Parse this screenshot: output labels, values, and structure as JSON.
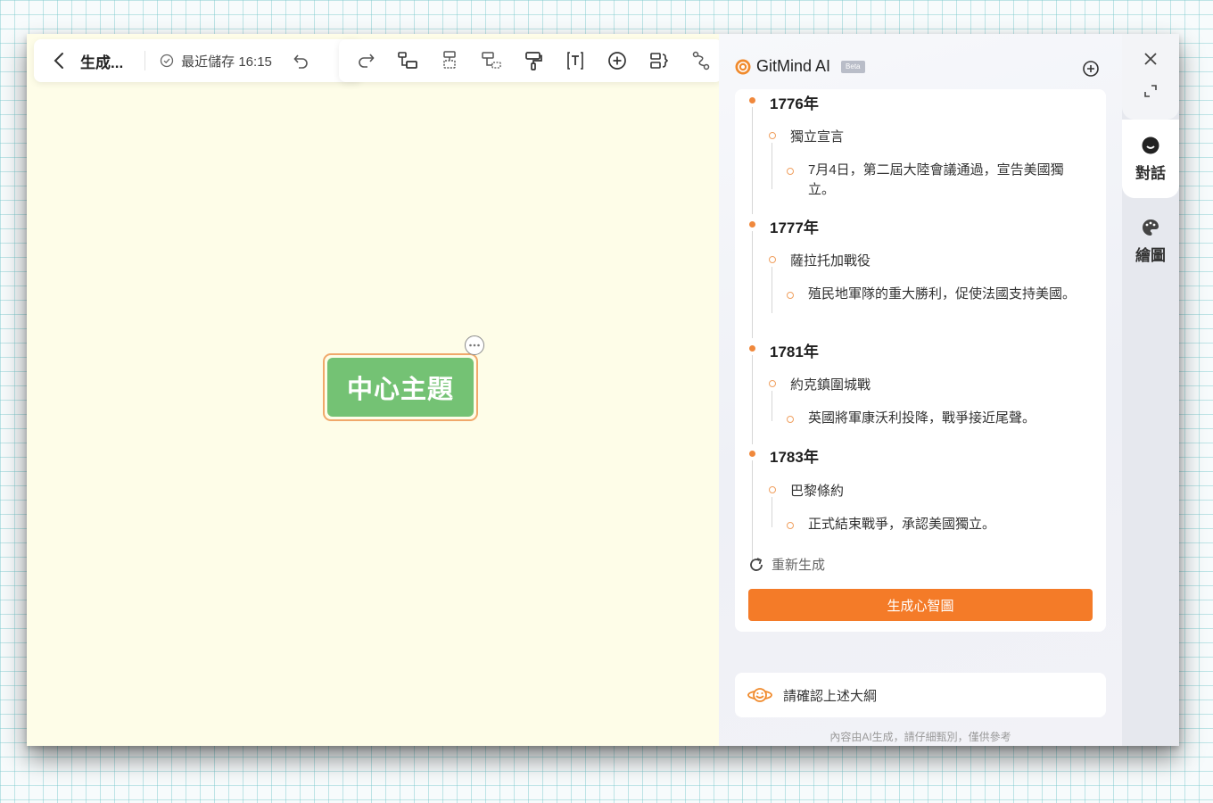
{
  "toolbar": {
    "doc_title": "生成...",
    "save_status": "最近儲存 16:15",
    "icons": [
      "back-icon",
      "check-circle-icon",
      "undo-icon",
      "redo-icon",
      "child-node-icon",
      "sibling-node-icon",
      "parent-node-icon",
      "format-painter-icon",
      "text-icon",
      "add-icon",
      "summary-icon",
      "relation-icon"
    ]
  },
  "canvas": {
    "central_topic": "中心主題",
    "background": "#fefde8",
    "node_fill": "#74c274",
    "node_border": "#f0a86a"
  },
  "ai_panel": {
    "title": "GitMind AI",
    "badge": "Beta",
    "outline": [
      {
        "year": "1776年",
        "event": "獨立宣言",
        "detail": "7月4日，第二屆大陸會議通過，宣告美國獨立。"
      },
      {
        "year": "1777年",
        "event": "薩拉托加戰役",
        "detail": "殖民地軍隊的重大勝利，促使法國支持美國。"
      },
      {
        "year": "1781年",
        "event": "約克鎮圍城戰",
        "detail": "英國將軍康沃利投降，戰爭接近尾聲。"
      },
      {
        "year": "1783年",
        "event": "巴黎條約",
        "detail": "正式結束戰爭，承認美國獨立。"
      }
    ],
    "regenerate_label": "重新生成",
    "generate_button": "生成心智圖",
    "confirm_prompt": "請確認上述大綱",
    "disclaimer": "內容由AI生成，請仔細甄別，僅供參考",
    "accent_color": "#f47b28"
  },
  "side_rail": {
    "chat_label": "對話",
    "draw_label": "繪圖"
  }
}
